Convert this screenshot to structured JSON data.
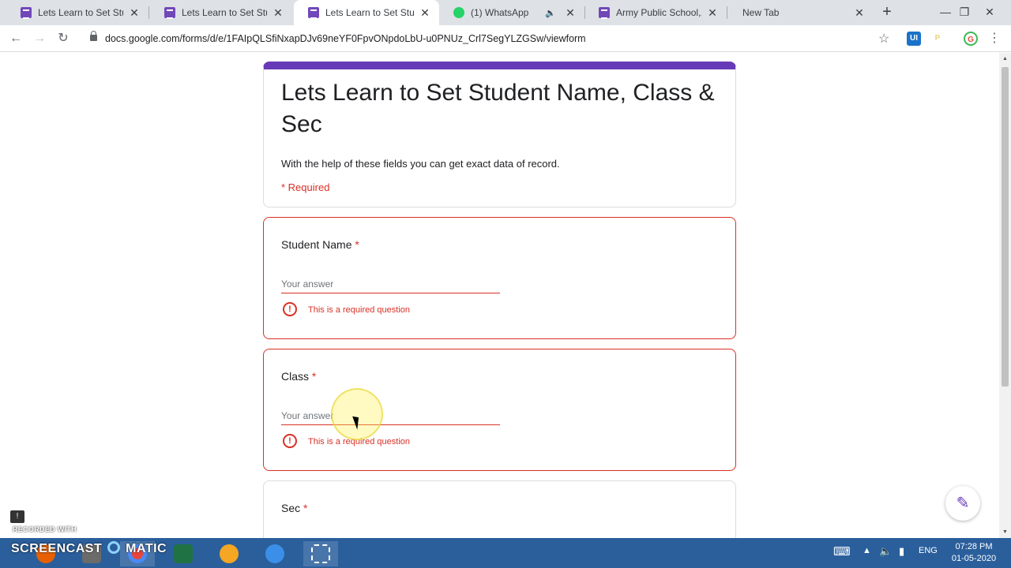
{
  "browser": {
    "tabs": [
      {
        "title": "Lets Learn to Set Studen",
        "icon": "forms-icon",
        "active": false
      },
      {
        "title": "Lets Learn to Set Studen",
        "icon": "forms-icon",
        "active": false
      },
      {
        "title": "Lets Learn to Set Studen",
        "icon": "forms-icon",
        "active": true
      },
      {
        "title": "(1) WhatsApp",
        "icon": "whatsapp-icon",
        "active": false
      },
      {
        "title": "Army Public School,Ahm",
        "icon": "forms-icon",
        "active": false
      },
      {
        "title": "New Tab",
        "icon": "",
        "active": false
      }
    ],
    "url": "docs.google.com/forms/d/e/1FAIpQLSfiNxapDJv69neYF0FpvONpdoLbU-u0PNUz_Crl7SegYLZGSw/viewform",
    "extensions": [
      "UI",
      "P"
    ]
  },
  "form": {
    "title": "Lets Learn to Set Student Name, Class & Sec",
    "description": "With the help of these fields you can get exact data of record.",
    "required_note": "* Required",
    "questions": [
      {
        "label": "Student Name",
        "required_mark": "*",
        "placeholder": "Your answer",
        "error": "This is a required question"
      },
      {
        "label": "Class",
        "required_mark": "*",
        "placeholder": "Your answer",
        "error": "This is a required question"
      },
      {
        "label": "Sec",
        "required_mark": "*"
      }
    ]
  },
  "taskbar": {
    "language": "ENG",
    "time": "07:28 PM",
    "date": "01-05-2020"
  },
  "watermark": {
    "line1": "RECORDED WITH",
    "line2": "SCREENCAST",
    "line3": "MATIC"
  },
  "colors": {
    "accent": "#673ab7",
    "error": "#d93025",
    "taskbar": "#2a5f9c"
  }
}
